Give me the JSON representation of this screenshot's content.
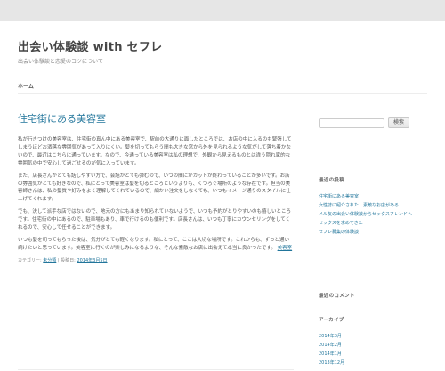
{
  "site": {
    "title": "出会い体験談 with セフレ",
    "description": "出会い体験談と恋愛のコツについて"
  },
  "nav": {
    "home_label": "ホーム"
  },
  "post": {
    "title": "住宅街にある美容室",
    "paragraphs": [
      "私が行きつけの美容室は、住宅街の真ん中にある美容室で、駅前の大通りに面したところでは、お店の中に入るのも緊張してしまうほどお洒落な雰囲気があって入りにくい。髪を切ってもらう間も大きな窓から外を見られるような気がして落ち着かないので、最近はこちらに通っています。なので、今通っている美容室は私の理想で、外観から見えるものとは違う隠れ家的な雰囲気の中で安心して過ごせるのが気に入っています。",
      "また、店長さんがとても話しやすい方で、会話がとても弾むので、いつの間にかカットが終わっていることが多いです。お店の雰囲気がとても好きなので、私にとって美容室は髪を切るところというよりも、くつろぐ場所のような存在です。担当の美容師さんは、私の髪質や好みをよく理解してくれているので、細かい注文をしなくても、いつもイメージ通りのスタイルに仕上げてくれます。",
      "でも、決して派手な店ではないので、地元の方にもあまり知られていないようで、いつも予約がとりやすいのも嬉しいところです。住宅街の中にあるので、駐車場もあり、車で行けるのも便利です。店長さんは、いつも丁寧にカウンセリングをしてくれるので、安心して任せることができます。",
      "いつも髪を切ってもらった後は、気分がとても軽くなります。私にとって、ここは大切な場所です。これからも、ずっと通い続けたいと思っています。美容室に行くのが楽しみになるような、そんな素敵なお店に出会えて本当に良かったです。"
    ],
    "link_text": "美容室",
    "meta_category_prefix": "カテゴリー: ",
    "meta_category": "未分類",
    "meta_middle": " | 投稿日: ",
    "meta_date": "2014年3月5日"
  },
  "sidebar": {
    "search_placeholder": "",
    "search_button": "検索",
    "recent_title": "最近の投稿",
    "recent_posts": [
      "住宅街にある美容室",
      "女性誌に紹介された、素敵なお店がある",
      "メル友の出会い体験談からセックスフレンドへ",
      "セックスを求めてきた",
      "セフレ募集の体験談"
    ],
    "comments_title": "最近のコメント",
    "archives_title": "アーカイブ",
    "archives": [
      "2014年3月",
      "2014年2月",
      "2014年1月",
      "2013年12月"
    ]
  }
}
